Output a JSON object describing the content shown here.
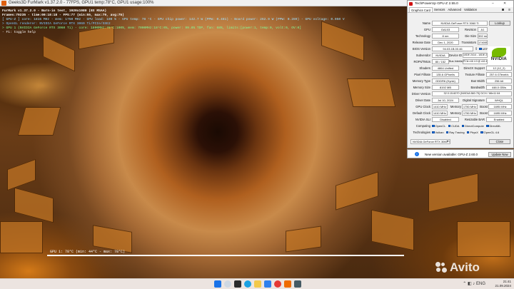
{
  "furmark": {
    "window_title": "Geeks3D FurMark v1.37.2.0 - 77FPS, GPU1 temp:78°C, GPU1 usage:100%",
    "hud_lines": [
      {
        "text": "FurMark v1.37.2.0 - Burn-in test, 1920x1080 (8X MSAA)",
        "color": "#ffffff"
      },
      {
        "text": "Frames:79235 - time:00:18:18 - FPS:77 (min:55, max:79, avg:75)",
        "color": "#ffffff"
      },
      {
        "text": "[ GPU-Z ] core: 1815 MHz - mem: 1750 MHz - GPU load: 100 % - GPU temp: 78 °C - GPU chip power: 142.7 W (PPW: 0.481) - Board power: 262.9 W (PPW: 0.289) - GPU voltage: 0.950 V",
        "color": "#9fe0ff"
      },
      {
        "text": "> OpenGL renderer: NVIDIA GeForce RTX 3060 Ti/PCIe/SSE2",
        "color": "#7ec8ff"
      },
      {
        "text": "> GPU 1 (NVIDIA GeForce RTX 3060 Ti) - core: 1800MHz:78°C:100%, mem: 7000MHz:18°C:6%, power: 99.8% TDP, fan: 68%, limits:[power:1, temp:0, volt:0, OV:0]",
        "color": "#80ff9a"
      },
      {
        "text": "- F1: toggle help",
        "color": "#ffffff"
      }
    ],
    "graph_label": "GPU 1: 78°C (min: 44°C - max: 78°C)"
  },
  "gpuz": {
    "title": "TechPowerUp GPU-Z 2.55.0",
    "tabs": [
      "Graphics Card",
      "Sensors",
      "Advanced",
      "Validation"
    ],
    "lookup_label": "Lookup",
    "fields": {
      "name": {
        "label": "Name",
        "value": "NVIDIA GeForce RTX 3060 Ti"
      },
      "gpu": {
        "label": "GPU",
        "value": "GA103"
      },
      "revision": {
        "label": "Revision",
        "value": "A1"
      },
      "technology": {
        "label": "Technology",
        "value": "8 nm"
      },
      "die_size": {
        "label": "Die Size",
        "value": "392 mm²"
      },
      "release_date": {
        "label": "Release Date",
        "value": "Dec 1, 2020"
      },
      "transistors": {
        "label": "Transistors",
        "value": "17400M"
      },
      "bios_version": {
        "label": "BIOS Version",
        "value": "94.03.1B.00.46"
      },
      "uefi": {
        "label": "UEFI"
      },
      "subvendor": {
        "label": "Subvendor",
        "value": "NVIDIA"
      },
      "device_id": {
        "label": "Device ID",
        "value": "10DE 2414 - 10DE 2414"
      },
      "rops": {
        "label": "ROPs/TMUs",
        "value": "80 / 152"
      },
      "bus_interface": {
        "label": "Bus Interface",
        "value": "PCIe x16 4.0 @ x16 4.0"
      },
      "shaders": {
        "label": "Shaders",
        "value": "4864 Unified"
      },
      "directx": {
        "label": "DirectX Support",
        "value": "12 (12_2)"
      },
      "pixel_fillrate": {
        "label": "Pixel Fillrate",
        "value": "135.6 GPixel/s"
      },
      "texture_fillrate": {
        "label": "Texture Fillrate",
        "value": "257.6 GTexel/s"
      },
      "memory_type": {
        "label": "Memory Type",
        "value": "GDDR6 (Hynix)"
      },
      "bus_width": {
        "label": "Bus Width",
        "value": "256 bit"
      },
      "memory_size": {
        "label": "Memory Size",
        "value": "8192 MB"
      },
      "bandwidth": {
        "label": "Bandwidth",
        "value": "448.0 GB/s"
      },
      "driver_version": {
        "label": "Driver Version",
        "value": "32.0.15.6070 (NVIDIA 560.70) DCH / Win11 64"
      },
      "driver_date": {
        "label": "Driver Date",
        "value": "Jul 10, 2024"
      },
      "digital_signature": {
        "label": "Digital Signature",
        "value": "WHQL"
      },
      "gpu_clock": {
        "label": "GPU Clock",
        "value": "1410 MHz",
        "mem_label": "Memory",
        "mem_value": "1750 MHz",
        "boost_label": "Boost",
        "boost_value": "1695 MHz"
      },
      "default_clock": {
        "label": "Default Clock",
        "value": "1410 MHz",
        "mem_label": "Memory",
        "mem_value": "1750 MHz",
        "boost_label": "Boost",
        "boost_value": "1695 MHz"
      },
      "nvidia_sli": {
        "label": "NVIDIA SLI",
        "value": "Disabled",
        "rbar_label": "Resizable BAR",
        "rbar_value": "Enabled"
      },
      "computing": {
        "label": "Computing",
        "items": [
          "OpenCL",
          "CUDA",
          "DirectCompute",
          "DirectML"
        ]
      },
      "technologies": {
        "label": "Technologies",
        "items": [
          "Vulkan",
          "Ray Tracing",
          "PhysX",
          "OpenGL 4.6"
        ]
      }
    },
    "gpu_select": "NVIDIA GeForce RTX 3060 Ti",
    "close_label": "Close",
    "vendor_logo": "NVIDIA"
  },
  "notification": {
    "message": "New version available: GPU-Z 2.60.0",
    "button": "Update Now"
  },
  "watermark": "Avito",
  "taskbar": {
    "tray_lang": "ENG",
    "time": "21:41",
    "date": "21.09.2024",
    "icons": [
      "start-icon",
      "search-icon",
      "task-view-icon",
      "edge-icon",
      "explorer-icon",
      "store-icon",
      "yandex-icon",
      "furmark-icon",
      "gpuz-icon",
      "settings-icon"
    ]
  }
}
